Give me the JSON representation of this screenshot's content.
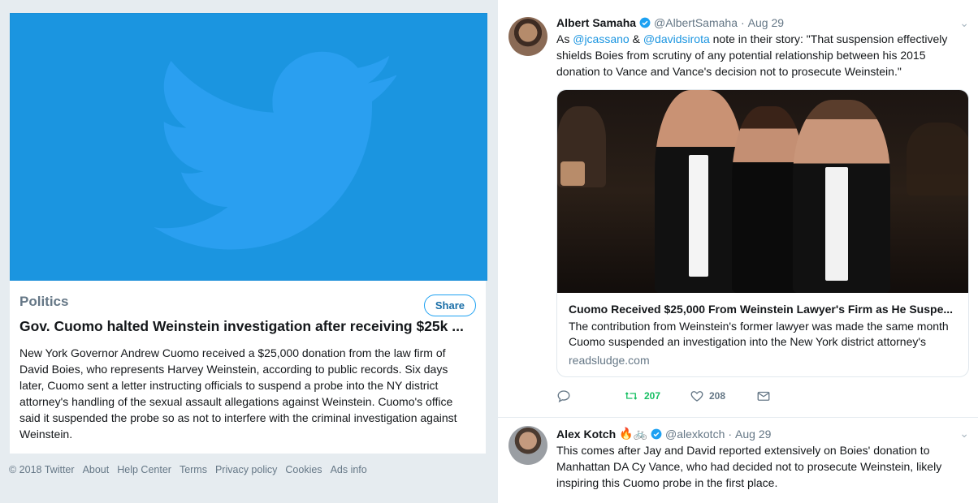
{
  "moment": {
    "category": "Politics",
    "share_label": "Share",
    "title": "Gov. Cuomo halted Weinstein investigation after receiving $25k ...",
    "description": "New York Governor Andrew Cuomo received a $25,000 donation from the law firm of David Boies, who represents Harvey Weinstein, according to public records. Six days later, Cuomo sent a letter instructing officials to suspend a probe into the NY district attorney's handling of the sexual assault allegations against Weinstein. Cuomo's office said it suspended the probe so as not to interfere with the criminal investigation against Weinstein."
  },
  "footer": {
    "copyright": "© 2018 Twitter",
    "links": [
      "About",
      "Help Center",
      "Terms",
      "Privacy policy",
      "Cookies",
      "Ads info"
    ]
  },
  "tweets": [
    {
      "name": "Albert Samaha",
      "handle": "@AlbertSamaha",
      "time": "Aug 29",
      "text_parts": [
        "As ",
        "@jcassano",
        " & ",
        "@davidsirota",
        " note in their story: \"That suspension effectively shields Boies from scrutiny of any potential relationship between his 2015 donation to Vance and Vance's decision not to prosecute Weinstein.\""
      ],
      "card": {
        "title": "Cuomo Received $25,000 From Weinstein Lawyer's Firm as He Suspe...",
        "description": "The contribution from Weinstein's former lawyer was made the same month Cuomo suspended an investigation into the New York district attorney's",
        "domain": "readsludge.com"
      },
      "retweets": "207",
      "likes": "208"
    },
    {
      "name": "Alex Kotch",
      "emoji": "🔥🚲",
      "handle": "@alexkotch",
      "time": "Aug 29",
      "text": "This comes after Jay and David reported extensively on Boies' donation to Manhattan DA Cy Vance, who had decided not to prosecute Weinstein, likely inspiring this Cuomo probe in the first place."
    }
  ],
  "colors": {
    "brand": "#1da1f2",
    "hero": "#1b95e0",
    "retweet": "#17bf63"
  }
}
